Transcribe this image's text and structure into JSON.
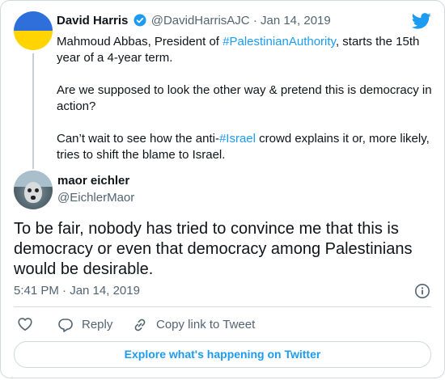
{
  "parent_tweet": {
    "author_name": "David Harris",
    "author_handle": "@DavidHarrisAJC",
    "separator": "·",
    "date": "Jan 14, 2019",
    "paragraphs": [
      {
        "pre": "Mahmoud Abbas, President of ",
        "hashtag": "#PalestinianAuthority",
        "post": ", starts the 15th year of a 4-year term."
      },
      {
        "pre": "Are we supposed to look the other way & pretend this is democracy in action?",
        "hashtag": "",
        "post": ""
      },
      {
        "pre": "Can’t wait to see how the anti-",
        "hashtag": "#Israel",
        "post": " crowd explains it or, more likely, tries to shift the blame to Israel."
      }
    ]
  },
  "reply_tweet": {
    "author_name": "maor eichler",
    "author_handle": "@EichlerMaor",
    "text": "To be fair, nobody has tried to convince me that this is democracy or even that democracy among Palestinians would be desirable.",
    "timestamp": "5:41 PM · Jan 14, 2019"
  },
  "actions": {
    "reply_label": "Reply",
    "copy_link_label": "Copy link to Tweet"
  },
  "explore_button_label": "Explore what's happening on Twitter",
  "colors": {
    "accent": "#1d9bf0",
    "secondary_text": "#536471",
    "border": "#cfd9de"
  },
  "icons": [
    "twitter-bird-icon",
    "verified-badge-icon",
    "info-icon",
    "heart-icon",
    "reply-bubble-icon",
    "link-icon"
  ]
}
